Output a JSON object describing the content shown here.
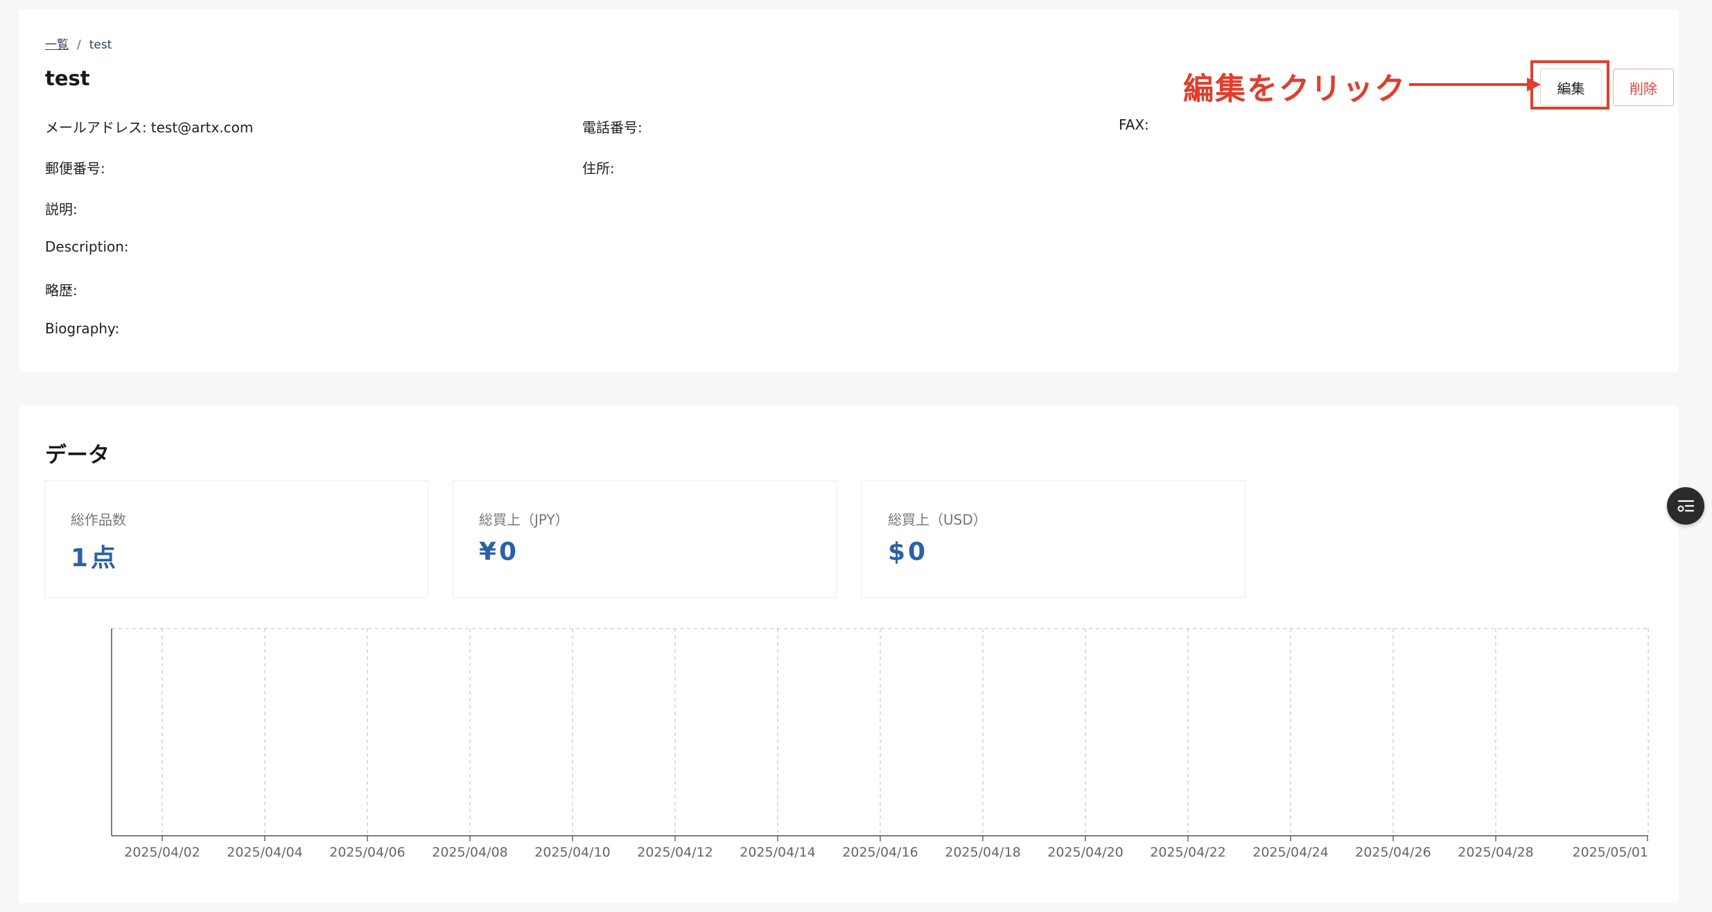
{
  "breadcrumb": {
    "list_link": "一覧",
    "separator": "/",
    "current": "test"
  },
  "page_title": "test",
  "fields": {
    "email_label": "メールアドレス:",
    "email_value": "test@artx.com",
    "phone_label": "電話番号:",
    "fax_label": "FAX:",
    "postal_label": "郵便番号:",
    "address_label": "住所:",
    "description_ja_label": "説明:",
    "description_en_label": "Description:",
    "bio_ja_label": "略歴:",
    "bio_en_label": "Biography:"
  },
  "actions": {
    "edit_label": "編集",
    "delete_label": "削除"
  },
  "annotation": {
    "text": "編集をクリック",
    "color": "#e03e2d"
  },
  "data_section": {
    "title": "データ",
    "stats": [
      {
        "label": "総作品数",
        "value": "1点"
      },
      {
        "label": "総買上（JPY）",
        "value": "¥0"
      },
      {
        "label": "総買上（USD）",
        "value": "$0"
      }
    ]
  },
  "chart_data": {
    "type": "line",
    "x": [
      "2025/04/02",
      "2025/04/04",
      "2025/04/06",
      "2025/04/08",
      "2025/04/10",
      "2025/04/12",
      "2025/04/14",
      "2025/04/16",
      "2025/04/18",
      "2025/04/20",
      "2025/04/22",
      "2025/04/24",
      "2025/04/26",
      "2025/04/28",
      "2025/05/01"
    ],
    "series": [],
    "grid": true
  },
  "colors": {
    "accent": "#2b62a6",
    "danger": "#d9443b",
    "annotation": "#e03e2d"
  },
  "fab": {
    "icon": "list-settings-icon"
  }
}
